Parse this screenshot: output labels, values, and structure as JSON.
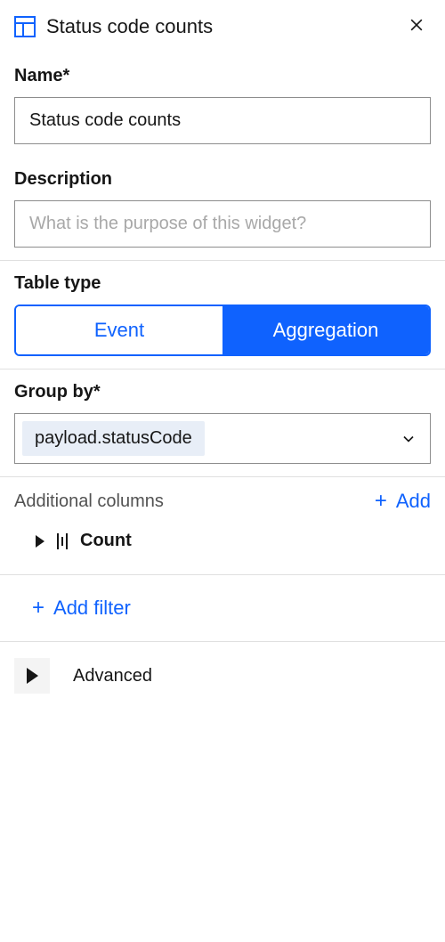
{
  "header": {
    "title": "Status code counts"
  },
  "name": {
    "label": "Name*",
    "value": "Status code counts"
  },
  "description": {
    "label": "Description",
    "placeholder": "What is the purpose of this widget?"
  },
  "tableType": {
    "label": "Table type",
    "options": {
      "event": "Event",
      "aggregation": "Aggregation"
    }
  },
  "groupBy": {
    "label": "Group by*",
    "value": "payload.statusCode"
  },
  "additionalColumns": {
    "label": "Additional columns",
    "addLabel": "Add",
    "items": [
      {
        "name": "Count"
      }
    ]
  },
  "filter": {
    "addLabel": "Add filter"
  },
  "advanced": {
    "label": "Advanced"
  }
}
